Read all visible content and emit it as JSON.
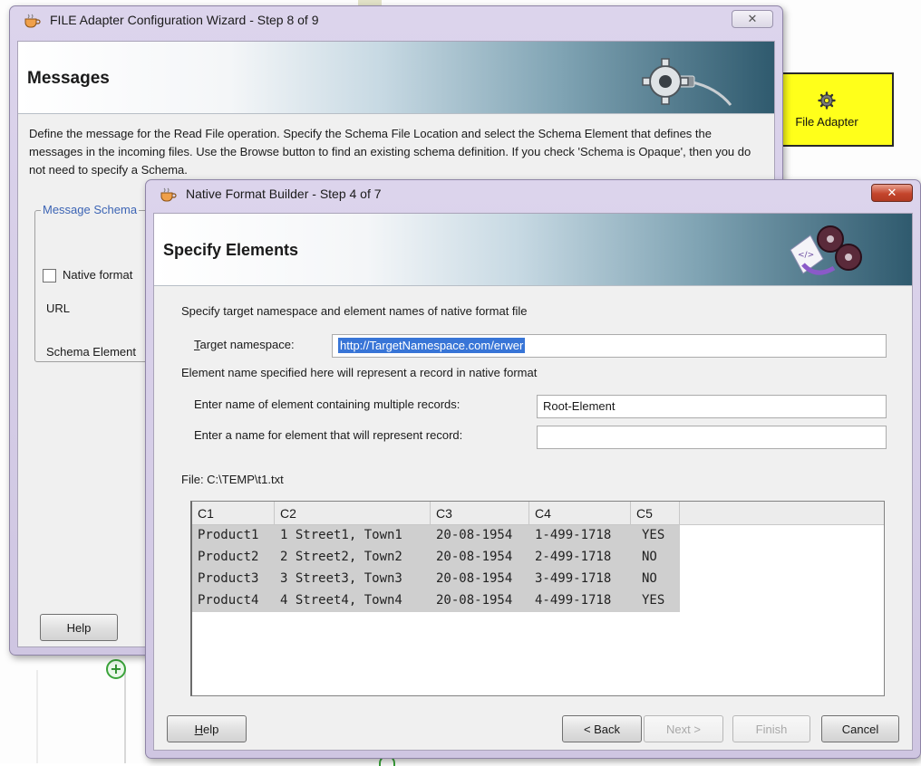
{
  "colors": {
    "window_frame": "#d6cee6",
    "banner_dark": "#2f5a6e",
    "selection": "#3875d7",
    "adapter_yellow": "#ffff1a",
    "close_red": "#c4452c"
  },
  "background": {
    "file_adapter_label": "File Adapter",
    "icons": [
      "gear-icon",
      "add-circle-icon"
    ]
  },
  "wizard1": {
    "title": "FILE Adapter Configuration Wizard - Step 8 of 9",
    "close_glyph": "✕",
    "banner_title": "Messages",
    "description": "Define the message for the Read File operation.  Specify the Schema File Location and select the Schema Element that defines the messages in the incoming files. Use the Browse button to find an existing schema definition. If you check 'Schema is Opaque', then you do not need to specify a Schema.",
    "group_legend": "Message Schema",
    "native_format_label": "Native format",
    "url_label": "URL",
    "schema_element_label": "Schema Element",
    "help_button": "Help"
  },
  "wizard2": {
    "title": "Native Format Builder - Step 4 of 7",
    "close_glyph": "✕",
    "banner_title": "Specify Elements",
    "intro": "Specify target namespace and element names of native format file",
    "target_namespace_label": "Target namespace:",
    "target_namespace_value": "http://TargetNamespace.com/erwer",
    "element_note": "Element name specified here will represent a record in native format",
    "multi_record_label": "Enter name of element containing multiple records:",
    "multi_record_value": "Root-Element",
    "record_label": "Enter a name for element that will represent record:",
    "record_value": "",
    "file_label": "File: C:\\TEMP\\t1.txt",
    "table": {
      "columns": [
        "C1",
        "C2",
        "C3",
        "C4",
        "C5"
      ],
      "rows": [
        [
          "Product1",
          "1 Street1, Town1",
          "20-08-1954",
          "1-499-1718",
          "YES"
        ],
        [
          "Product2",
          "2 Street2, Town2",
          "20-08-1954",
          "2-499-1718",
          "NO"
        ],
        [
          "Product3",
          "3 Street3, Town3",
          "20-08-1954",
          "3-499-1718",
          "NO"
        ],
        [
          "Product4",
          "4 Street4, Town4",
          "20-08-1954",
          "4-499-1718",
          "YES"
        ]
      ]
    },
    "buttons": {
      "help": "Help",
      "back": "< Back",
      "next": "Next >",
      "finish": "Finish",
      "cancel": "Cancel"
    }
  }
}
